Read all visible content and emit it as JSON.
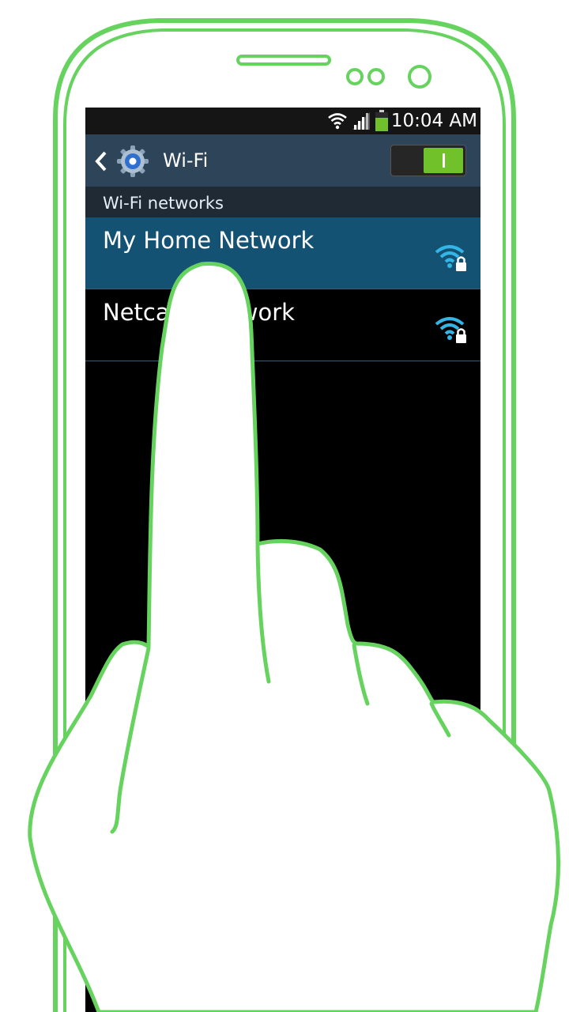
{
  "status_bar": {
    "time": "10:04 AM",
    "icons": [
      "wifi-icon",
      "signal-icon",
      "battery-icon"
    ],
    "battery_color": "#71c12b"
  },
  "action_bar": {
    "title": "Wi-Fi",
    "back_icon": "chevron-left-icon",
    "app_icon": "settings-gear-icon",
    "toggle_state": "on",
    "toggle_color": "#71c12b"
  },
  "section": {
    "label": "Wi-Fi networks"
  },
  "networks": [
    {
      "name": "My Home Network",
      "icon": "wifi-locked-icon",
      "selected": true
    },
    {
      "name": "Netcafe Network",
      "icon": "wifi-locked-icon",
      "selected": false
    }
  ],
  "colors": {
    "outline_green": "#66d35f",
    "selected_row": "#145273",
    "action_bar": "#2e4459",
    "wifi_blue": "#33b5e5"
  }
}
